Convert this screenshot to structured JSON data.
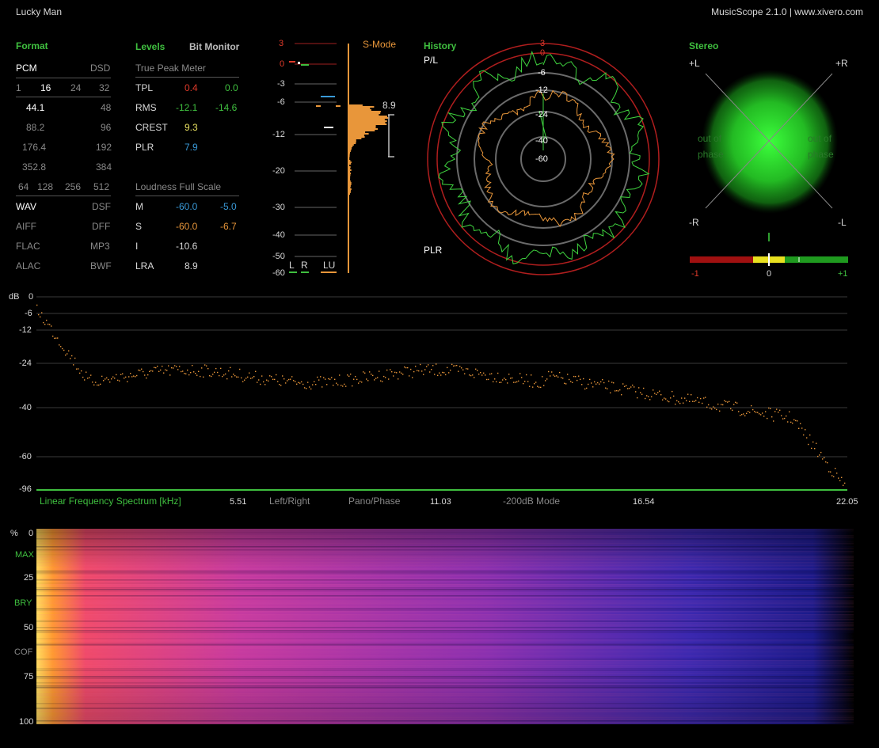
{
  "window": {
    "title": "Lucky Man",
    "app": "MusicScope 2.1.0 | www.xivero.com"
  },
  "format": {
    "header": "Format",
    "pcm": "PCM",
    "dsd": "DSD",
    "bits": [
      "1",
      "16",
      "24",
      "32"
    ],
    "rates": [
      {
        "pcm": "44.1",
        "dsd": "48"
      },
      {
        "pcm": "88.2",
        "dsd": "96"
      },
      {
        "pcm": "176.4",
        "dsd": "192"
      },
      {
        "pcm": "352.8",
        "dsd": "384"
      }
    ],
    "dsd_rates": [
      "64",
      "128",
      "256",
      "512"
    ],
    "containers": [
      {
        "left": "WAV",
        "right": "DSF"
      },
      {
        "left": "AIFF",
        "right": "DFF"
      },
      {
        "left": "FLAC",
        "right": "MP3"
      },
      {
        "left": "ALAC",
        "right": "BWF"
      }
    ]
  },
  "levels": {
    "header": "Levels",
    "bit_monitor": "Bit Monitor",
    "true_peak_label": "True Peak Meter",
    "rows": [
      {
        "label": "TPL",
        "l": "0.4",
        "r": "0.0"
      },
      {
        "label": "RMS",
        "l": "-12.1",
        "r": "-14.6"
      },
      {
        "label": "CREST",
        "l": "9.3"
      },
      {
        "label": "PLR",
        "l": "7.9"
      }
    ],
    "loudness_label": "Loudness Full Scale",
    "loud_rows": [
      {
        "label": "M",
        "l": "-60.0",
        "r": "-5.0"
      },
      {
        "label": "S",
        "l": "-60.0",
        "r": "-6.7"
      },
      {
        "label": "I",
        "l": "-10.6"
      },
      {
        "label": "LRA",
        "l": "8.9"
      }
    ]
  },
  "meter": {
    "smode": "S-Mode",
    "scale": [
      "3",
      "0",
      "-3",
      "-6",
      "-12",
      "-20",
      "-30",
      "-40",
      "-50",
      "-60"
    ],
    "value": "8.9",
    "legend": {
      "l": "L",
      "r": "R",
      "lu": "LU"
    }
  },
  "history": {
    "header": "History",
    "pl": "P/L",
    "plr": "PLR",
    "rings": [
      "3",
      "0",
      "-6",
      "-12",
      "-24",
      "-40",
      "-60"
    ]
  },
  "stereo": {
    "header": "Stereo",
    "corners": {
      "tl": "+L",
      "tr": "+R",
      "bl": "-R",
      "br": "-L"
    },
    "out_of_phase_l": [
      "out of",
      "phase"
    ],
    "out_of_phase_r": [
      "out of",
      "phase"
    ],
    "correlation": {
      "min": "-1",
      "mid": "0",
      "max": "+1"
    }
  },
  "spectrum": {
    "unit": "dB",
    "y_ticks": [
      "0",
      "-6",
      "-12",
      "-24",
      "-40",
      "-60",
      "-96"
    ],
    "x_ticks": [
      "5.51",
      "11.03",
      "16.54",
      "22.05"
    ],
    "title": "Linear Frequency Spectrum [kHz]",
    "modes": [
      "Left/Right",
      "Pano/Phase",
      "-200dB Mode"
    ]
  },
  "spectrogram": {
    "unit": "%",
    "labels": [
      {
        "text": "0"
      },
      {
        "text": "MAX",
        "green": true
      },
      {
        "text": "25"
      },
      {
        "text": "BRY",
        "green": true
      },
      {
        "text": "50"
      },
      {
        "text": "COF",
        "grey": true
      },
      {
        "text": "75"
      },
      {
        "text": "100"
      }
    ]
  }
}
